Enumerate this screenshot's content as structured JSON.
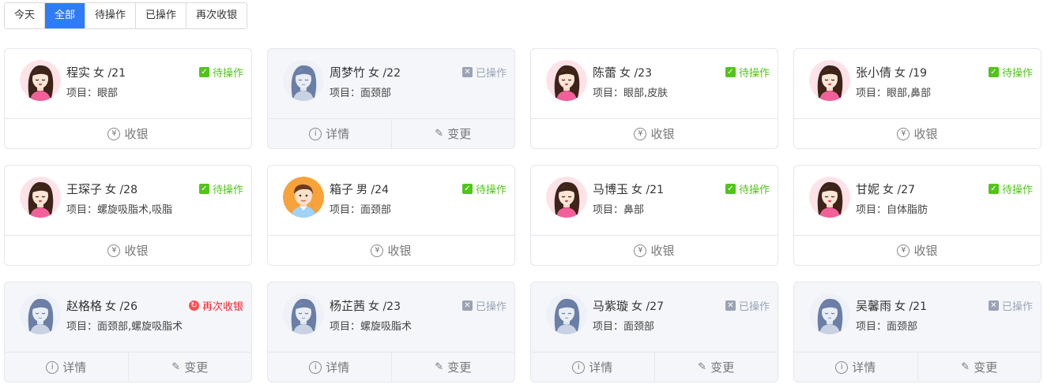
{
  "tabs": [
    {
      "label": "今天",
      "active": false
    },
    {
      "label": "全部",
      "active": true
    },
    {
      "label": "待操作",
      "active": false
    },
    {
      "label": "已操作",
      "active": false
    },
    {
      "label": "再次收银",
      "active": false
    }
  ],
  "colors": {
    "accent": "#2f7cf6",
    "pending": "#52c41a",
    "done": "#9aa3b5",
    "again": "#f5222d"
  },
  "labels": {
    "project_prefix": "项目：",
    "cashier": "收银",
    "details": "详情",
    "change": "变更",
    "yuan_symbol": "¥",
    "info_symbol": "i",
    "pen_symbol": "✎"
  },
  "cards": [
    {
      "name": "程实",
      "meta": "女 /21",
      "project": "眼部",
      "status": "待操作",
      "status_type": "pending",
      "avatar": "female-avatar"
    },
    {
      "name": "周梦竹",
      "meta": "女 /22",
      "project": "面颈部",
      "status": "已操作",
      "status_type": "done",
      "avatar": "gray-female-avatar"
    },
    {
      "name": "陈蕾",
      "meta": "女 /23",
      "project": "眼部,皮肤",
      "status": "待操作",
      "status_type": "pending",
      "avatar": "female-avatar"
    },
    {
      "name": "张小倩",
      "meta": "女 /19",
      "project": "眼部,鼻部",
      "status": "待操作",
      "status_type": "pending",
      "avatar": "female-avatar"
    },
    {
      "name": "王琛子",
      "meta": "女 /28",
      "project": "螺旋吸脂术,吸脂",
      "status": "待操作",
      "status_type": "pending",
      "avatar": "female-avatar"
    },
    {
      "name": "箱子",
      "meta": "男 /24",
      "project": "面颈部",
      "status": "待操作",
      "status_type": "pending",
      "avatar": "male-avatar"
    },
    {
      "name": "马博玉",
      "meta": "女 /21",
      "project": "鼻部",
      "status": "待操作",
      "status_type": "pending",
      "avatar": "female-avatar"
    },
    {
      "name": "甘妮",
      "meta": "女 /27",
      "project": "自体脂肪",
      "status": "待操作",
      "status_type": "pending",
      "avatar": "female-avatar"
    },
    {
      "name": "赵格格",
      "meta": "女 /26",
      "project": "面颈部,螺旋吸脂术",
      "status": "再次收银",
      "status_type": "again",
      "avatar": "gray-female-avatar"
    },
    {
      "name": "杨芷茜",
      "meta": "女 /23",
      "project": "螺旋吸脂术",
      "status": "已操作",
      "status_type": "done",
      "avatar": "gray-female-avatar"
    },
    {
      "name": "马紫璇",
      "meta": "女 /27",
      "project": "面颈部",
      "status": "已操作",
      "status_type": "done",
      "avatar": "gray-female-avatar"
    },
    {
      "name": "吴馨雨",
      "meta": "女 /21",
      "project": "面颈部",
      "status": "已操作",
      "status_type": "done",
      "avatar": "gray-female-avatar"
    }
  ]
}
